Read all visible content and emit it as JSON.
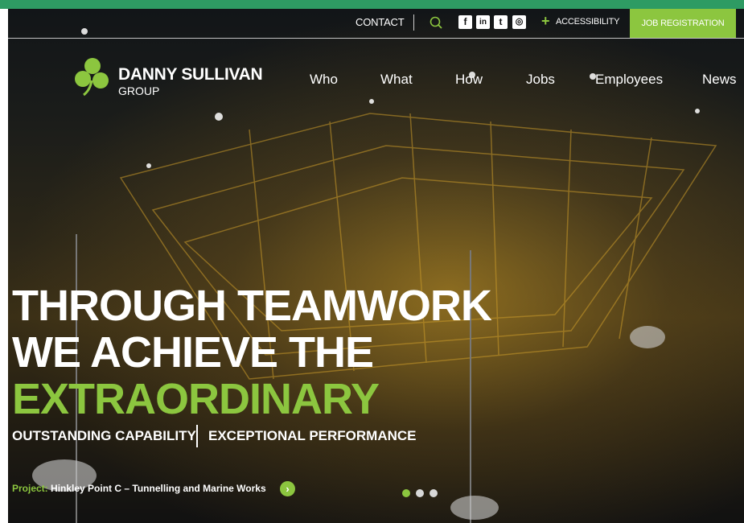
{
  "utility": {
    "contact": "CONTACT",
    "social": [
      {
        "icon": "facebook-icon",
        "glyph": "f"
      },
      {
        "icon": "linkedin-icon",
        "glyph": "in"
      },
      {
        "icon": "twitter-icon",
        "glyph": "t"
      },
      {
        "icon": "instagram-icon",
        "glyph": "◎"
      }
    ],
    "accessibility_plus": "+",
    "accessibility": "ACCESSIBILITY",
    "job_registration": "JOB REGISTRATION"
  },
  "brand": {
    "name": "DANNY SULLIVAN",
    "sub": "GROUP"
  },
  "nav": [
    "Who",
    "What",
    "How",
    "Jobs",
    "Employees",
    "News"
  ],
  "hero": {
    "line1": "THROUGH TEAMWORK",
    "line2": "WE ACHIEVE THE",
    "line3": "EXTRAORDINARY",
    "tag1": "OUTSTANDING CAPABILITY",
    "tag2": "EXCEPTIONAL PERFORMANCE",
    "project_label": "Project:",
    "project_name": "Hinkley Point C – Tunnelling and Marine Works",
    "arrow": "›"
  },
  "carousel": {
    "count": 3,
    "active": 1
  },
  "colors": {
    "accent": "#8cc63f",
    "topbar": "#2e9b63"
  }
}
